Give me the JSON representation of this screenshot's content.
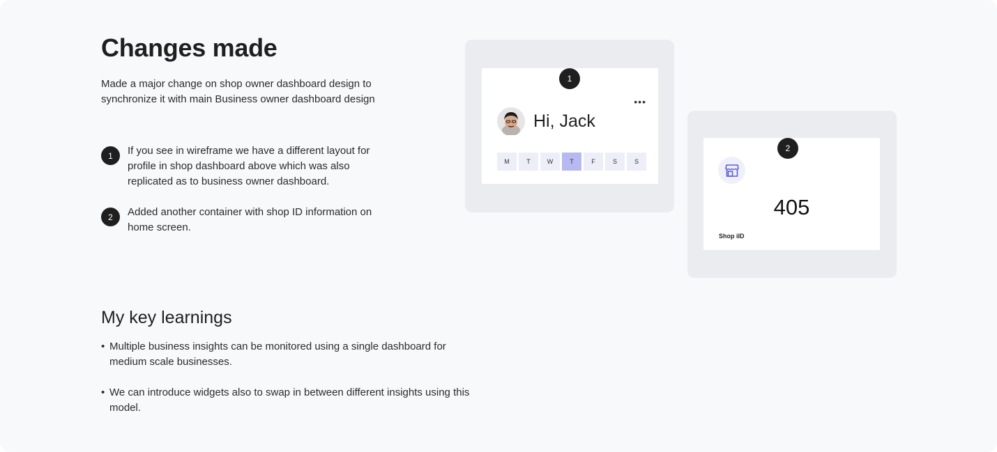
{
  "changes": {
    "title": "Changes made",
    "intro": "Made a major change on shop owner dashboard design to synchronize it with main Business owner dashboard design",
    "items": [
      {
        "number": "1",
        "text": "If you see in wireframe we have a different layout for profile in shop dashboard above which was also replicated as to business owner dashboard."
      },
      {
        "number": "2",
        "text": "Added another container with shop ID information on home screen."
      }
    ]
  },
  "learnings": {
    "title": "My key learnings",
    "bullet": "•",
    "items": [
      "Multiple business insights can be monitored using a single dashboard for medium scale businesses.",
      "We can introduce widgets also to swap in between different insights using this model."
    ]
  },
  "profile_card": {
    "badge": "1",
    "more_icon": "more-horizontal-icon",
    "greeting": "Hi, Jack",
    "days": [
      "M",
      "T",
      "W",
      "T",
      "F",
      "S",
      "S"
    ],
    "active_day": 3,
    "accent": "#b7b9f1"
  },
  "shop_card": {
    "badge": "2",
    "icon": "store-icon",
    "value": "405",
    "label": "Shop iID"
  }
}
